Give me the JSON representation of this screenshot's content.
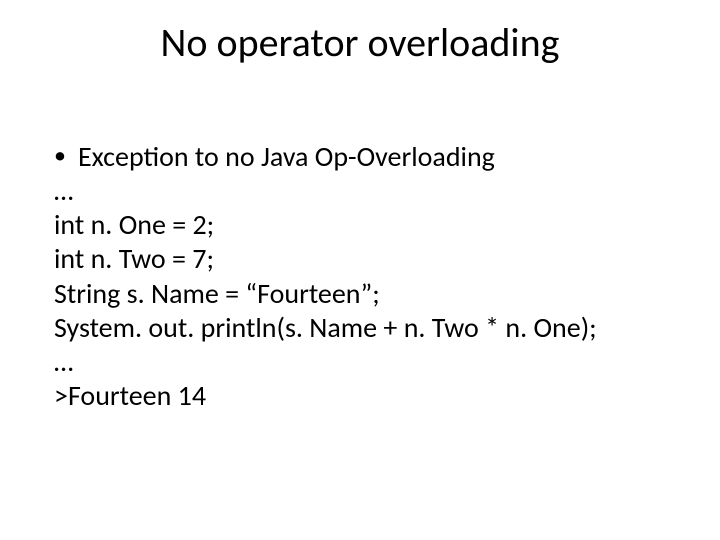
{
  "title": "No operator overloading",
  "bullet": "Exception to no Java Op-Overloading",
  "lines": {
    "l0": "…",
    "l1": "int n. One = 2;",
    "l2": "int n. Two = 7;",
    "l3": "String s. Name = “Fourteen”;",
    "l4": "System. out. println(s. Name + n. Two * n. One);",
    "l5": "…",
    "l6": ">Fourteen 14"
  }
}
